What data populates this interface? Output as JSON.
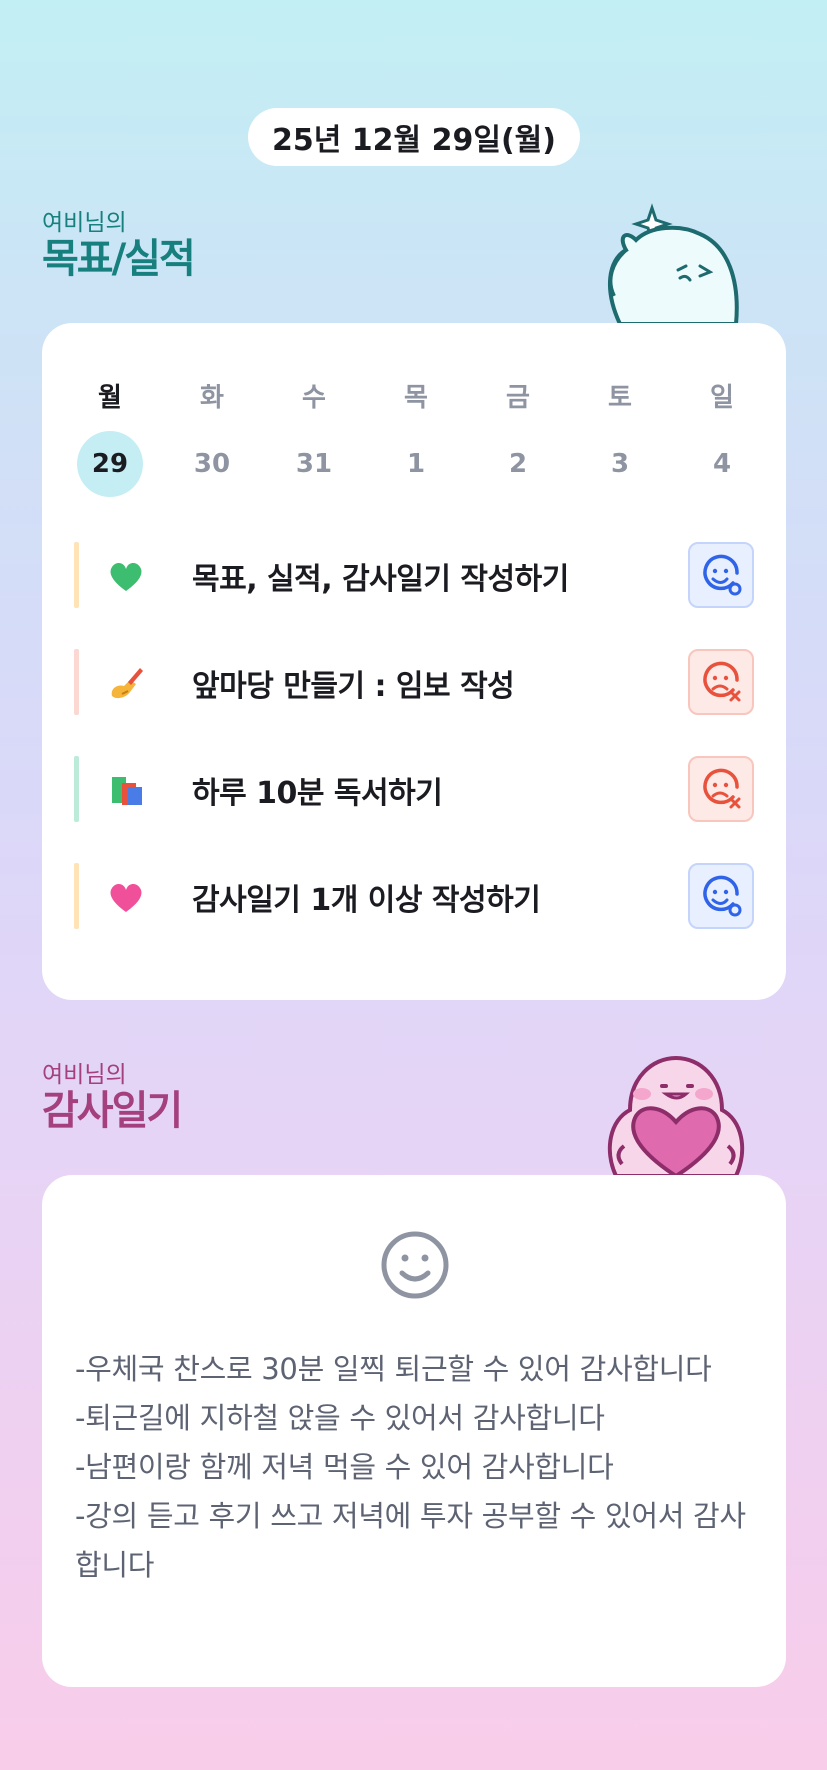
{
  "date": "25년 12월 29일(월)",
  "goal_section": {
    "subtitle": "여비님의",
    "title": "목표/실적"
  },
  "week": {
    "days": [
      "월",
      "화",
      "수",
      "목",
      "금",
      "토",
      "일"
    ],
    "dates": [
      "29",
      "30",
      "31",
      "1",
      "2",
      "3",
      "4"
    ],
    "active_index": 0
  },
  "goals": [
    {
      "emoji": "green-heart-icon",
      "label": "목표, 실적, 감사일기 작성하기",
      "status": "done",
      "bar_color": "#fde3b5"
    },
    {
      "emoji": "writing-hand-icon",
      "label": "앞마당 만들기 : 임보 작성",
      "status": "fail",
      "bar_color": "#fbd8d2"
    },
    {
      "emoji": "books-icon",
      "label": "하루 10분 독서하기",
      "status": "fail",
      "bar_color": "#bdebd9"
    },
    {
      "emoji": "pink-heart-icon",
      "label": "감사일기 1개 이상 작성하기",
      "status": "done",
      "bar_color": "#fde3b5"
    }
  ],
  "gratitude_section": {
    "subtitle": "여비님의",
    "title": "감사일기",
    "lines": [
      "-우체국 찬스로 30분 일찍 퇴근할 수 있어 감사합니다",
      "-퇴근길에 지하철 앉을 수 있어서 감사합니다",
      "-남편이랑 함께 저녁 먹을 수 있어 감사합니다",
      "-강의 듣고 후기 쓰고 저녁에 투자 공부할 수 있어서 감사합니다"
    ]
  },
  "colors": {
    "goal_title": "#17807f",
    "gratitude_title": "#a3407d",
    "done_icon": "#2f63e8",
    "fail_icon": "#e8513c"
  }
}
